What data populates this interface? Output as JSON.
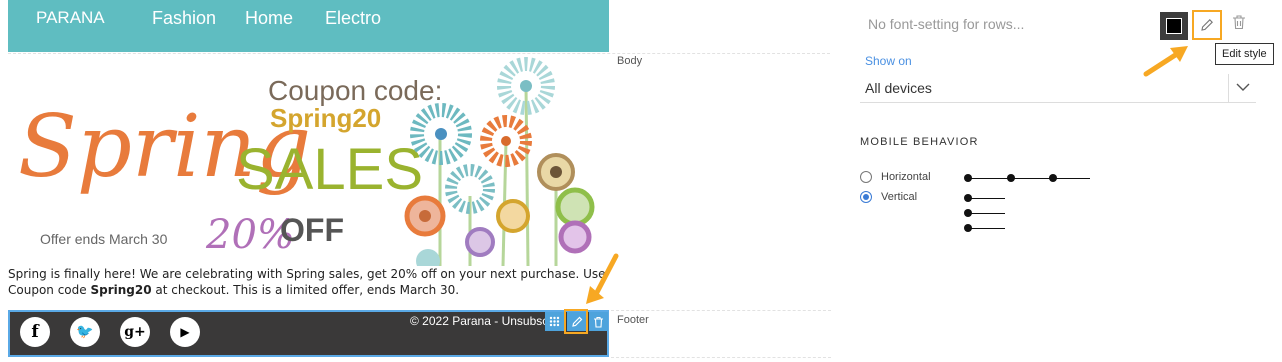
{
  "email": {
    "nav": [
      "PARANA",
      "Fashion",
      "Home",
      "Electro"
    ],
    "header_color": "#5fbdc1",
    "banner": {
      "coupon_label": "Coupon code:",
      "coupon_code": "Spring20",
      "headline_script": "Spring",
      "headline_sales": "SALES",
      "discount_script": "20%",
      "discount_off": "OFF",
      "offer_ends": "Offer ends March 30"
    },
    "body_text_1": "Spring is finally here! We are celebrating with Spring sales, get 20% off on your next purchase. Use Coupon code ",
    "body_text_bold": "Spring20",
    "body_text_2": " at checkout. This is a limited offer, ends March 30.",
    "footer": {
      "copyright": "© 2022 Parana - Unsubsc",
      "social_icons": [
        "facebook-icon",
        "twitter-icon",
        "google-plus-icon",
        "youtube-icon"
      ],
      "social_glyphs": [
        "f",
        "🐦",
        "g+",
        "▶"
      ]
    }
  },
  "section_labels": {
    "body": "Body",
    "footer": "Footer"
  },
  "panel": {
    "font_placeholder": "No font-setting for rows...",
    "tooltip": "Edit style",
    "show_on_label": "Show on",
    "show_on_value": "All devices",
    "mobile_behavior_title": "MOBILE BEHAVIOR",
    "options": [
      {
        "label": "Horizontal",
        "checked": false
      },
      {
        "label": "Vertical",
        "checked": true
      }
    ],
    "accent": "#f7a823",
    "link_color": "#4a90e2"
  }
}
